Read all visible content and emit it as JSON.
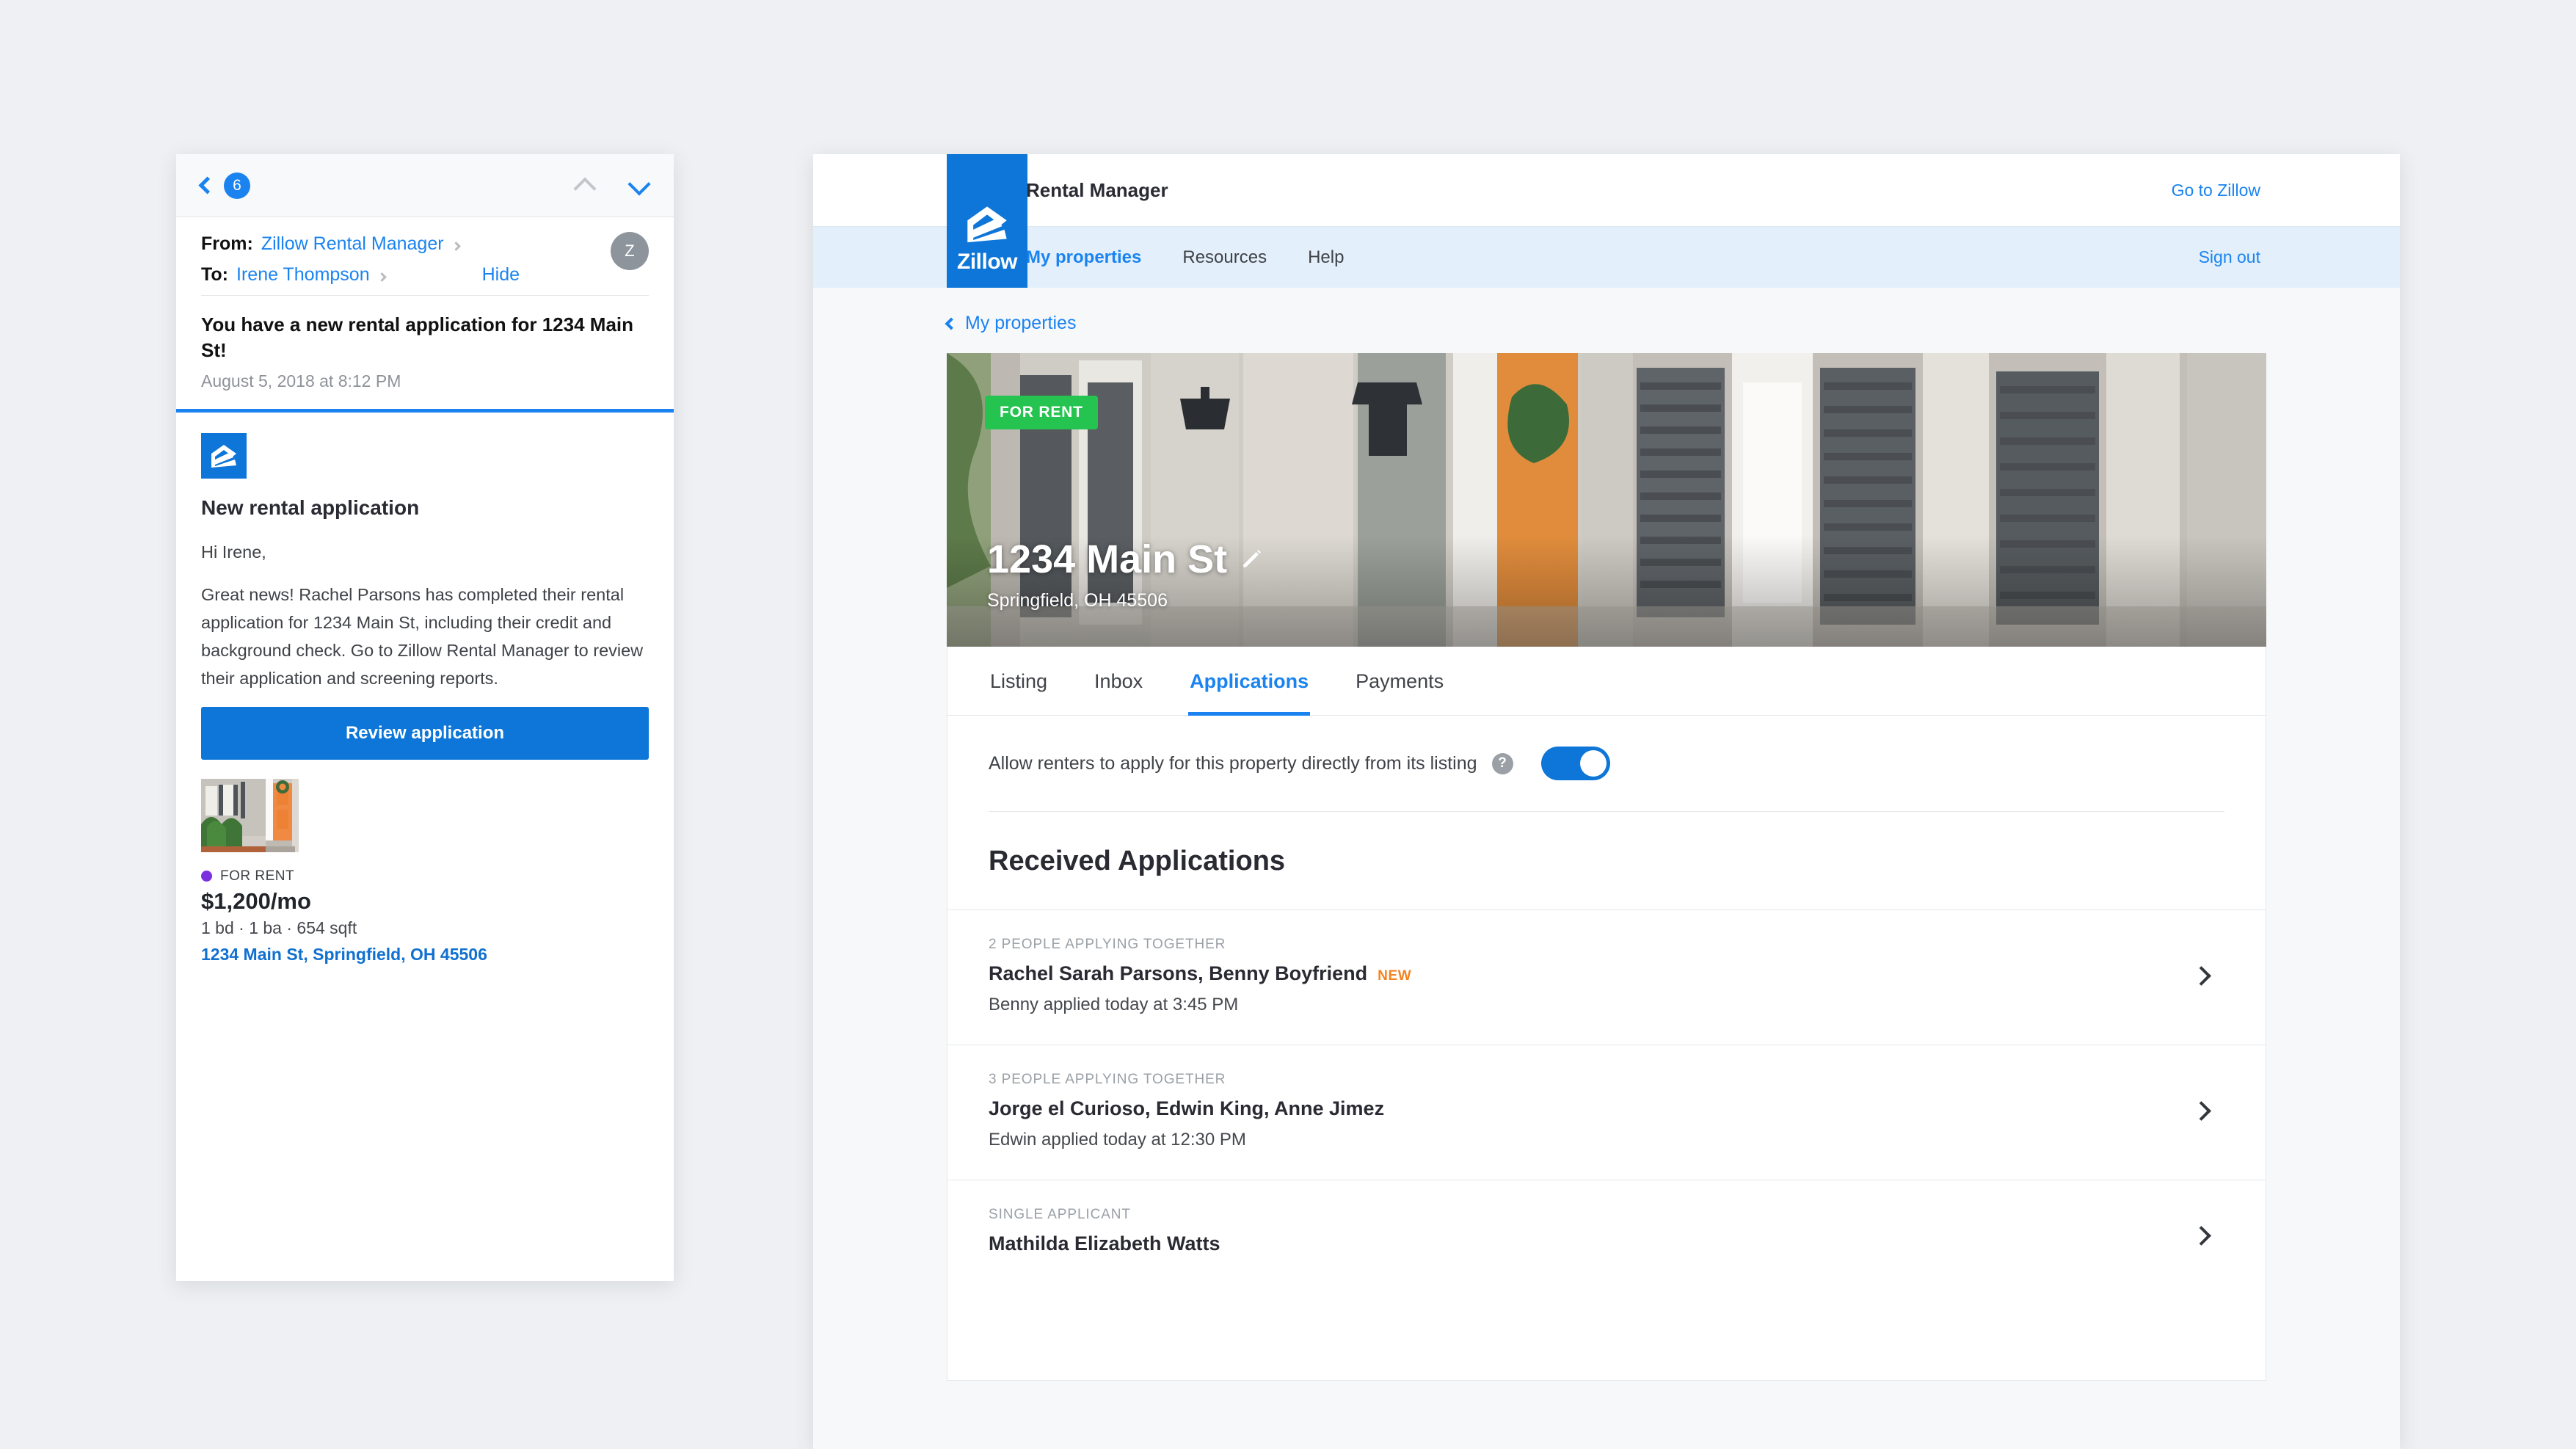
{
  "email": {
    "toolbar": {
      "back_icon": "back-chevron-icon",
      "unread_count": "6",
      "prev_icon": "chevron-up-icon",
      "next_icon": "chevron-down-icon"
    },
    "from_label": "From:",
    "from_value": "Zillow Rental Manager",
    "to_label": "To:",
    "to_value": "Irene Thompson",
    "hide_label": "Hide",
    "avatar_initial": "Z",
    "subject": "You have a new rental application for 1234 Main St!",
    "date": "August 5, 2018 at 8:12 PM",
    "body": {
      "heading": "New rental application",
      "greeting": "Hi Irene,",
      "paragraph": "Great news! Rachel Parsons has completed their rental application for 1234 Main St, including their credit and background check. Go to Zillow Rental Manager to review their application and screening reports.",
      "cta_label": "Review application"
    },
    "listing": {
      "status": "FOR RENT",
      "price": "$1,200/mo",
      "specs": "1 bd · 1 ba · 654 sqft",
      "address": "1234 Main St, Springfield, OH 45506"
    }
  },
  "rental_manager": {
    "brand_word": "Zillow",
    "header_title": "Rental Manager",
    "go_to_zillow": "Go to Zillow",
    "sign_out": "Sign out",
    "nav_items": [
      {
        "label": "My properties",
        "active": true
      },
      {
        "label": "Resources",
        "active": false
      },
      {
        "label": "Help",
        "active": false
      }
    ],
    "breadcrumb": "My properties",
    "hero": {
      "badge": "FOR RENT",
      "title": "1234 Main St",
      "subtitle": "Springfield, OH 45506",
      "edit_icon": "pencil-icon"
    },
    "tabs": [
      {
        "label": "Listing",
        "active": false
      },
      {
        "label": "Inbox",
        "active": false
      },
      {
        "label": "Applications",
        "active": true
      },
      {
        "label": "Payments",
        "active": false
      }
    ],
    "toggle": {
      "label": "Allow renters to apply for this property directly from its listing",
      "help_icon": "question-mark-icon",
      "state": "on"
    },
    "section_title": "Received Applications",
    "applications": [
      {
        "kicker": "2 PEOPLE APPLYING TOGETHER",
        "names": "Rachel Sarah Parsons, Benny Boyfriend",
        "badge": "NEW",
        "time": "Benny applied today at 3:45 PM"
      },
      {
        "kicker": "3 PEOPLE APPLYING TOGETHER",
        "names": "Jorge el Curioso, Edwin King, Anne Jimez",
        "badge": "",
        "time": "Edwin applied today at 12:30 PM"
      },
      {
        "kicker": "SINGLE APPLICANT",
        "names": "Mathilda Elizabeth Watts",
        "badge": "",
        "time": ""
      }
    ]
  },
  "colors": {
    "zillow_blue": "#0d76d8",
    "link_blue": "#1a83f0",
    "nav_band": "#e3f0fb",
    "for_rent_green": "#25c451",
    "new_orange": "#f5821f",
    "listing_dot_purple": "#7b2fe0"
  }
}
